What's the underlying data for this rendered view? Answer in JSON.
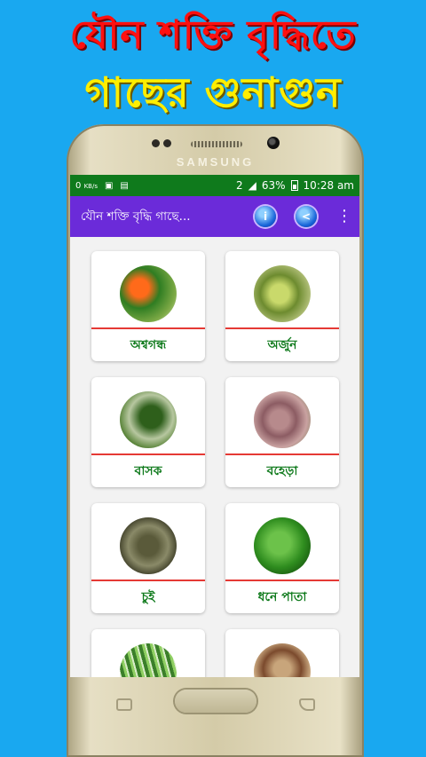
{
  "promo": {
    "line1": "যৌন শক্তি বৃদ্ধিতে",
    "line2": "গাছের গুনাগুন"
  },
  "device": {
    "brand": "SAMSUNG"
  },
  "status_bar": {
    "network_speed": "0",
    "network_unit": "KB/s",
    "sim": "2",
    "battery_percent": "63%",
    "time": "10:28 am"
  },
  "app_bar": {
    "title": "যৌন শক্তি বৃদ্ধি গাছে...",
    "info_icon": "info-icon",
    "share_icon": "share-icon",
    "overflow_icon": "more-vert-icon"
  },
  "items": [
    {
      "label": "অশ্বগন্ধ"
    },
    {
      "label": "অর্জুন"
    },
    {
      "label": "বাসক"
    },
    {
      "label": "বহেড়া"
    },
    {
      "label": "চুই"
    },
    {
      "label": "ধনে পাতা"
    },
    {
      "label": ""
    },
    {
      "label": ""
    }
  ],
  "colors": {
    "background": "#19a8f0",
    "status_bar": "#0f7a1c",
    "app_bar": "#6b2bd9",
    "label_text": "#0f7a1c",
    "divider": "#e53935",
    "promo_line1": "#ff1010",
    "promo_line2": "#ffee00"
  }
}
